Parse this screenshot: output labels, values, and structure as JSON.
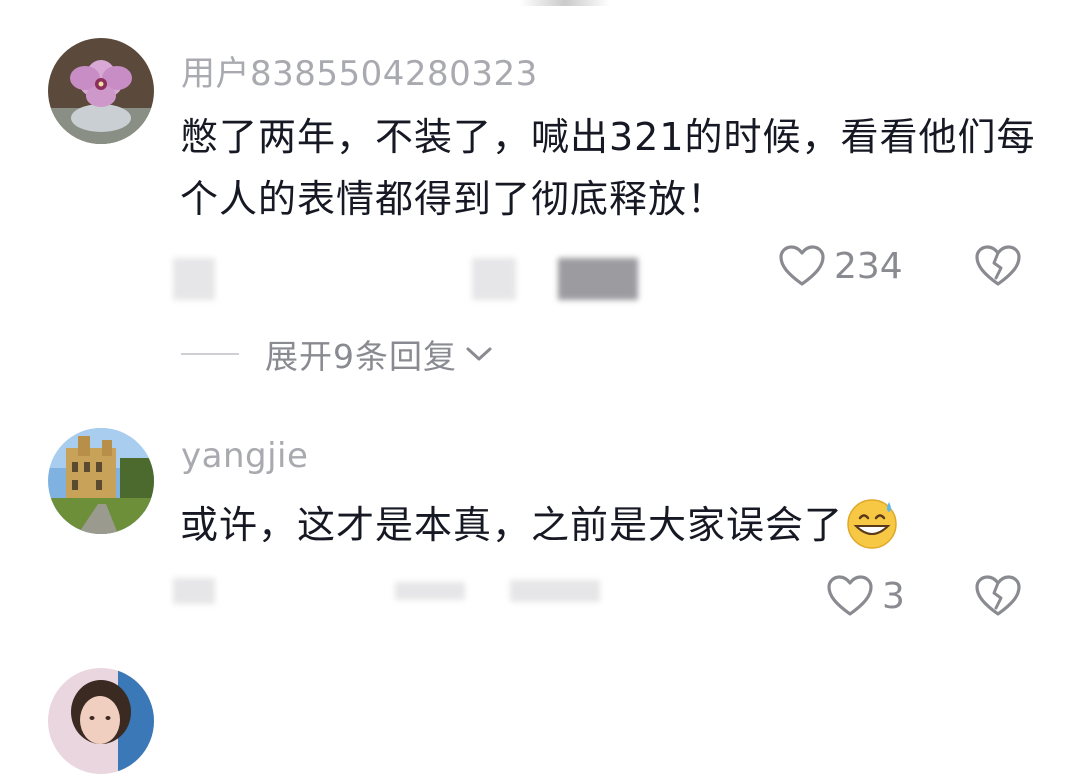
{
  "comments": [
    {
      "username": "用户8385504280323",
      "text": "憋了两年，不装了，喊出321的时候，看看他们每个人的表情都得到了彻底释放！",
      "like_count": "234",
      "expand_replies": "展开9条回复",
      "avatar_icon": "flower-avatar"
    },
    {
      "username": "yangjie",
      "text": "或许，这才是本真，之前是大家误会了",
      "emoji": "grinning-sweat-emoji",
      "like_count": "3",
      "avatar_icon": "castle-avatar"
    },
    {
      "avatar_icon": "person-avatar"
    }
  ],
  "colors": {
    "username": "#a9aab0",
    "text": "#161823",
    "meta": "#8a8b91"
  }
}
